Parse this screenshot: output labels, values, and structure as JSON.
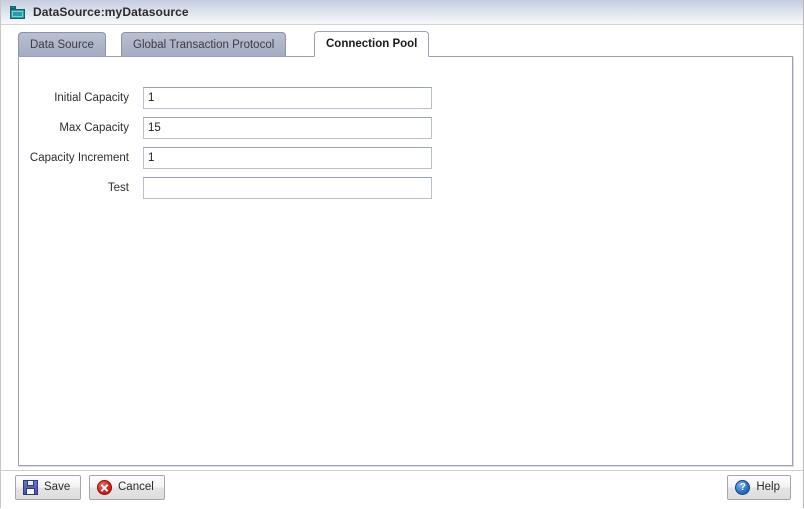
{
  "window": {
    "title": "DataSource:myDatasource",
    "icon": "datasource-folder-icon"
  },
  "tabs": [
    {
      "label": "Data Source",
      "active": false
    },
    {
      "label": "Global Transaction Protocol",
      "active": false
    },
    {
      "label": "Connection Pool",
      "active": true
    }
  ],
  "form": {
    "fields": [
      {
        "label": "Initial Capacity",
        "value": "1",
        "placeholder": ""
      },
      {
        "label": "Max Capacity",
        "value": "15",
        "placeholder": ""
      },
      {
        "label": "Capacity Increment",
        "value": "1",
        "placeholder": ""
      },
      {
        "label": "Test",
        "value": "",
        "placeholder": ""
      }
    ]
  },
  "buttons": {
    "save": {
      "label": "Save",
      "icon": "floppy-disk-icon"
    },
    "cancel": {
      "label": "Cancel",
      "icon": "red-circle-x-icon"
    },
    "help": {
      "label": "Help",
      "icon": "blue-circle-question-icon",
      "glyph": "?"
    }
  },
  "colors": {
    "titlebar_top": "#c5cee0",
    "titlebar_bottom": "#f7f8fa",
    "tab_inactive": "#aeb6ca",
    "tab_active": "#ffffff",
    "panel_border": "#9aa2b4",
    "icon_teal": "#2a9aa6",
    "icon_red": "#d8221a",
    "icon_blue": "#2b74c8",
    "icon_floppy_blue": "#4654ad"
  }
}
